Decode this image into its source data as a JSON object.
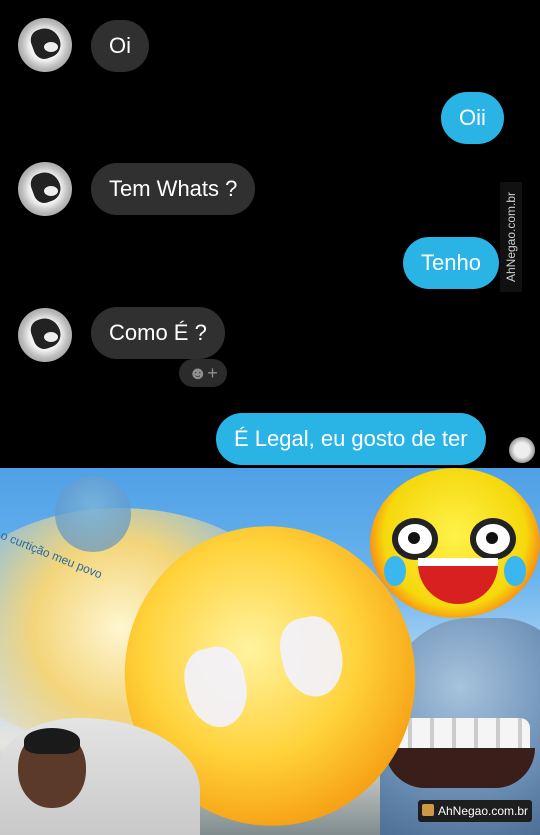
{
  "chat": {
    "messages": [
      {
        "from": "them",
        "text": "Oi"
      },
      {
        "from": "me",
        "text": "Oii"
      },
      {
        "from": "them",
        "text": "Tem Whats ?"
      },
      {
        "from": "me",
        "text": "Tenho"
      },
      {
        "from": "them",
        "text": "Como É ?"
      },
      {
        "from": "me",
        "text": "É  Legal, eu gosto de ter"
      }
    ],
    "reaction_button_label": "☻+",
    "side_watermark": "AhNegao.com.br"
  },
  "meme": {
    "ghost_caption": "o curtição meu povo",
    "badge_text": "AhNegao.com.br"
  },
  "colors": {
    "incoming_bubble": "#303030",
    "outgoing_bubble": "#2ab4e6",
    "background": "#000000"
  }
}
